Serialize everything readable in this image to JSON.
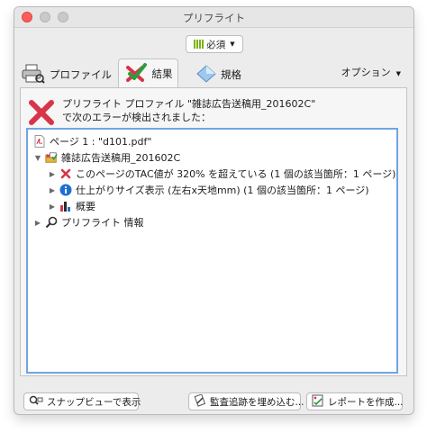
{
  "window": {
    "title": "プリフライト"
  },
  "toolbar": {
    "requirement_label": "必須"
  },
  "tabs": {
    "profile": "プロファイル",
    "results": "結果",
    "standards": "規格"
  },
  "options_label": "オプション",
  "error": {
    "line1": "プリフライト プロファイル \"雑誌広告送稿用_201602C\"",
    "line2": "で次のエラーが検出されました："
  },
  "tree": {
    "page": "ページ 1 : \"d101.pdf\"",
    "profile": "雑誌広告送稿用_201602C",
    "item_tac": "このページのTAC値が 320% を超えている  (1 個の該当箇所：1 ページ)",
    "item_size": "仕上がりサイズ表示 (左右x天地mm)    (1 個の該当箇所：1 ページ)",
    "item_overview": "概要",
    "preflight_info": "プリフライト 情報"
  },
  "buttons": {
    "snap": "スナップビューで表示",
    "audit": "監査追跡を埋め込む...",
    "report": "レポートを作成..."
  },
  "colors": {
    "error_red": "#d8344a",
    "check_green": "#2e9b3e",
    "selection_blue": "#6fa6e4"
  }
}
